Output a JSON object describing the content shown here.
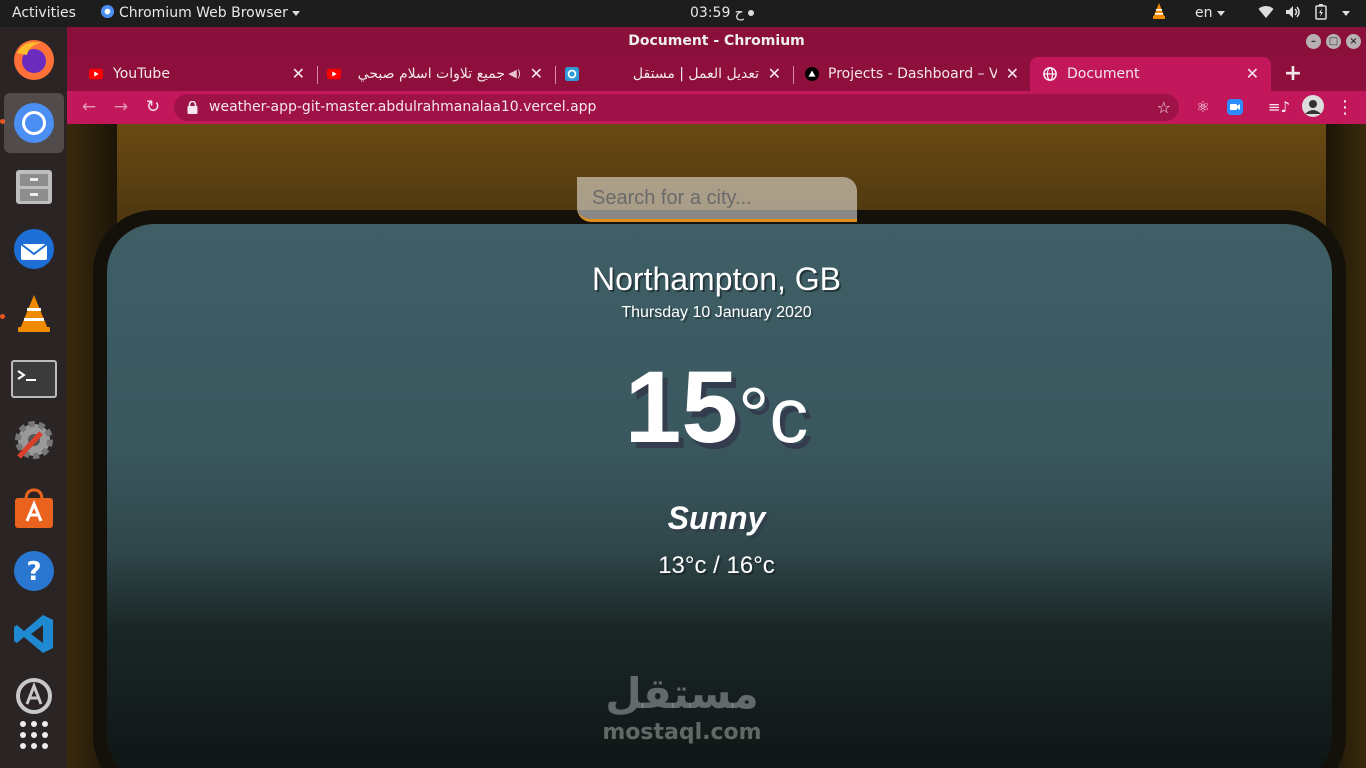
{
  "topbar": {
    "activities": "Activities",
    "app_menu": "Chromium Web Browser",
    "clock": "ح 03:59",
    "lang": "en"
  },
  "window": {
    "title": "Document - Chromium"
  },
  "tabs": [
    {
      "title": "YouTube",
      "favicon": "youtube-icon"
    },
    {
      "title": "جميع تلاوات اسلام صبحي",
      "favicon": "youtube-icon"
    },
    {
      "title": "تعديل العمل | مستقل",
      "favicon": "mostaql-icon"
    },
    {
      "title": "Projects - Dashboard – Vercel",
      "favicon": "vercel-icon"
    },
    {
      "title": "Document",
      "favicon": "globe-icon"
    }
  ],
  "toolbar": {
    "url": "weather-app-git-master.abdulrahmanalaa10.vercel.app"
  },
  "weather": {
    "search_placeholder": "Search for a city...",
    "city": "Northampton, GB",
    "date": "Thursday 10 January 2020",
    "temp_value": "15",
    "temp_unit": "°c",
    "condition": "Sunny",
    "hi_low": "13°c / 16°c"
  },
  "watermark": {
    "arabic": "مستقل",
    "latin": "mostaql.com"
  },
  "colors": {
    "tab_strip": "#8e0f3c",
    "active_tab": "#c2185b",
    "search_accent": "#df8e1d"
  }
}
